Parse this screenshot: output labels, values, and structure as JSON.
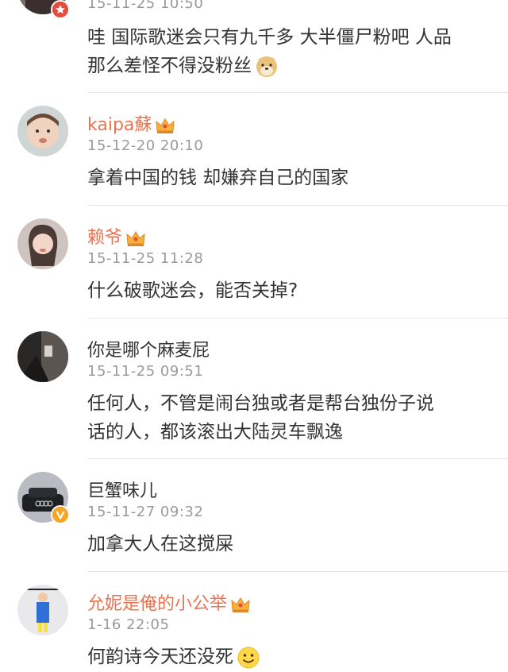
{
  "comments": [
    {
      "name": "",
      "time": "15-11-25 10:50",
      "lines": [
        "哇 国际歌迷会只有九千多 大半僵尸粉吧 人品",
        "那么差怪不得没粉丝"
      ],
      "emoji": "doge-emoji",
      "badge": "star-badge"
    },
    {
      "name": "kaipa蘇",
      "time": "15-12-20 20:10",
      "lines": [
        "拿着中国的钱 却嫌弃自己的国家"
      ],
      "crown": "vip-crown-icon"
    },
    {
      "name": "赖爷",
      "time": "15-11-25 11:28",
      "lines": [
        "什么破歌迷会，能否关掉?"
      ],
      "crown": "vip-crown-icon"
    },
    {
      "name": "你是哪个麻麦屁",
      "time": "15-11-25 09:51",
      "lines": [
        "任何人，不管是闹台独或者是帮台独份子说",
        "话的人，都该滚出大陆灵车飘逸"
      ]
    },
    {
      "name": "巨蟹味儿",
      "time": "15-11-27 09:32",
      "lines": [
        "加拿大人在这搅屎"
      ],
      "badge": "verified-v-badge"
    },
    {
      "name": "允妮是俺的小公举",
      "time": "1-16 22:05",
      "lines": [
        "何韵诗今天还没死"
      ],
      "crown": "vip-crown-icon",
      "emoji": "smile-emoji"
    }
  ],
  "colors": {
    "vip_name": "#eb7350",
    "normal_name": "#333333",
    "time": "#9a9a9a",
    "text": "#333333"
  }
}
